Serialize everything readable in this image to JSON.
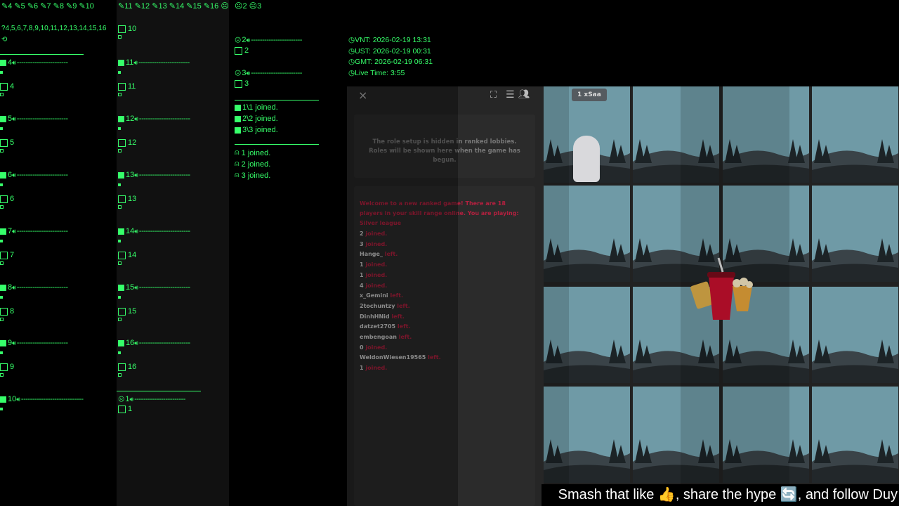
{
  "col1": {
    "header": "4, 5, 6, 7, 8, 9, 10",
    "header_nums": [
      "4",
      "5",
      "6",
      "7",
      "8",
      "9",
      "10"
    ],
    "numbers_line": "4,5,6,7,8,9,10,11,12,13,14,15,16",
    "entries": [
      {
        "label": "4",
        "sub": "4"
      },
      {
        "label": "5",
        "sub": "5"
      },
      {
        "label": "6",
        "sub": "6"
      },
      {
        "label": "7",
        "sub": "7"
      },
      {
        "label": "8",
        "sub": "8"
      },
      {
        "label": "9",
        "sub": "9"
      },
      {
        "label": "10",
        "sub": ""
      }
    ]
  },
  "col2": {
    "header_nums": [
      "11",
      "12",
      "13",
      "14",
      "15",
      "16",
      "1"
    ],
    "top_entry": "10",
    "entries": [
      {
        "label": "11",
        "sub": "11"
      },
      {
        "label": "12",
        "sub": "12"
      },
      {
        "label": "13",
        "sub": "13"
      },
      {
        "label": "14",
        "sub": "14"
      },
      {
        "label": "15",
        "sub": "15"
      },
      {
        "label": "16",
        "sub": "16"
      },
      {
        "label": "1",
        "sub": "1"
      }
    ]
  },
  "col3": {
    "header_nums": [
      "2",
      "3"
    ],
    "entries": [
      {
        "label": "2",
        "sub": "2"
      },
      {
        "label": "3",
        "sub": "3"
      }
    ],
    "joined_a": [
      "1\\1 joined.",
      "2\\2 joined.",
      "3\\3 joined."
    ],
    "joined_b": [
      "1 joined.",
      "2 joined.",
      "3 joined."
    ]
  },
  "times": {
    "vnt": "VNT: 2026-02-19 13:31",
    "ust": "UST: 2026-02-19 00:31",
    "gmt": "GMT: 2026-02-19 06:31",
    "live": "Live Time: 3:55"
  },
  "game": {
    "close": "×",
    "role_text": "The role setup is hidden in ranked lobbies. Roles will be shown here when the game has begun.",
    "welcome": "Welcome to a new ranked game! There are 18 players in your skill range online. You are playing: Silver league",
    "chat": [
      {
        "name": "2",
        "action": "joined."
      },
      {
        "name": "3",
        "action": "joined."
      },
      {
        "name": "Hange_",
        "action": "left."
      },
      {
        "name": "1",
        "action": "joined."
      },
      {
        "name": "1",
        "action": "joined."
      },
      {
        "name": "4",
        "action": "joined."
      },
      {
        "name": "x_Gemini",
        "action": "left."
      },
      {
        "name": "2tochuntzy",
        "action": "left."
      },
      {
        "name": "DinhHNid",
        "action": "left."
      },
      {
        "name": "datzet2705",
        "action": "left."
      },
      {
        "name": "embengoan",
        "action": "left."
      },
      {
        "name": "0",
        "action": "joined."
      },
      {
        "name": "WeldonWiesen19565",
        "action": "left."
      },
      {
        "name": "1",
        "action": "joined."
      }
    ],
    "player_badge": "1 xSaa"
  },
  "ticker": "Smash that like 👍, share the hype 🔄, and follow Duy",
  "colors": {
    "accent": "#36ff6a",
    "chat_red": "#b3203f",
    "tile_sky": "#6f9aa6"
  }
}
